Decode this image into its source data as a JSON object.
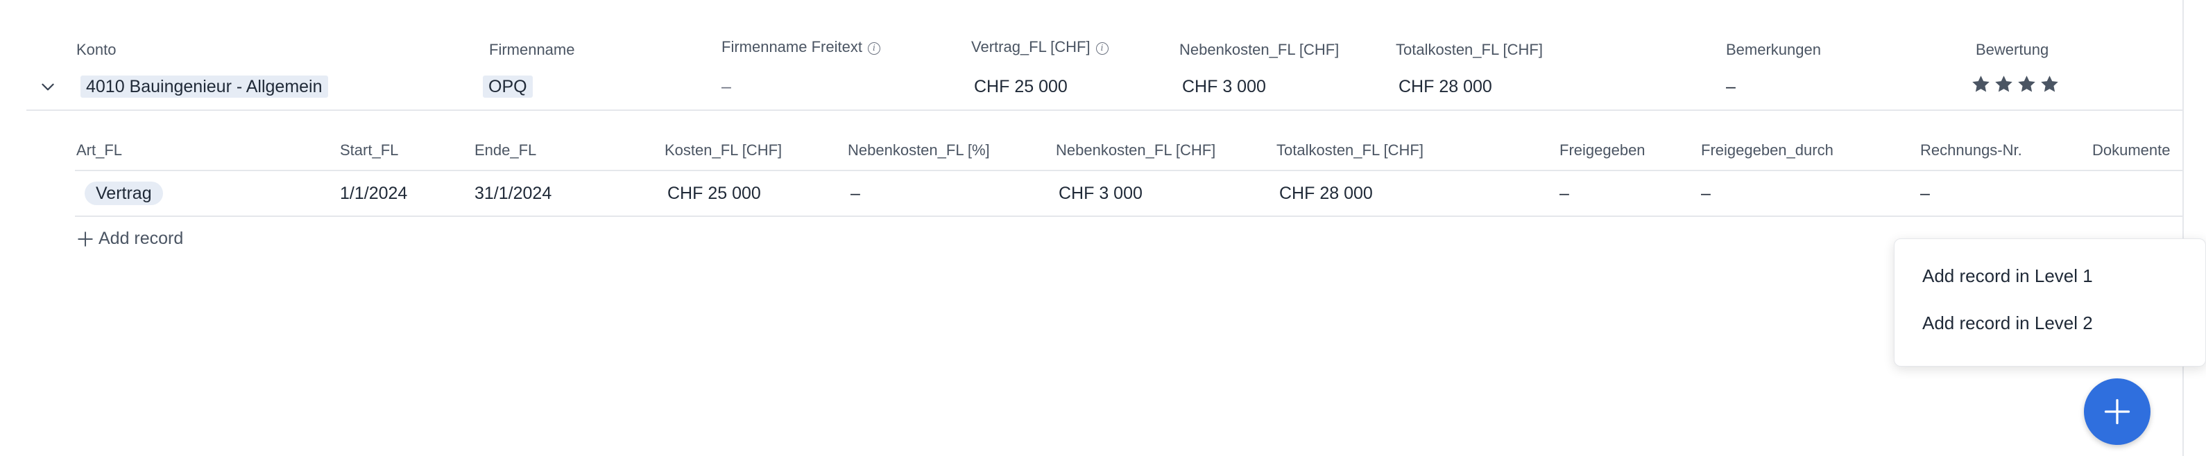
{
  "level1": {
    "headers": {
      "konto": "Konto",
      "firmenname": "Firmenname",
      "firmenname_freitext": "Firmenname Freitext",
      "vertrag": "Vertrag_FL [CHF]",
      "nebenkosten": "Nebenkosten_FL [CHF]",
      "totalkosten": "Totalkosten_FL [CHF]",
      "bemerkungen": "Bemerkungen",
      "bewertung": "Bewertung"
    },
    "row": {
      "konto": "4010 Bauingenieur - Allgemein",
      "firmenname": "OPQ",
      "firmenname_freitext": "–",
      "vertrag": "CHF 25 000",
      "nebenkosten": "CHF 3 000",
      "totalkosten": "CHF 28 000",
      "bemerkungen": "–",
      "bewertung_stars": 4
    }
  },
  "level2": {
    "headers": {
      "art": "Art_FL",
      "start": "Start_FL",
      "ende": "Ende_FL",
      "kosten": "Kosten_FL [CHF]",
      "nebenkosten_pct": "Nebenkosten_FL [%]",
      "nebenkosten_chf": "Nebenkosten_FL [CHF]",
      "totalkosten": "Totalkosten_FL [CHF]",
      "freigegeben": "Freigegeben",
      "freigegeben_durch": "Freigegeben_durch",
      "rechnungs_nr": "Rechnungs-Nr.",
      "dokumente": "Dokumente"
    },
    "row": {
      "art": "Vertrag",
      "start": "1/1/2024",
      "ende": "31/1/2024",
      "kosten": "CHF 25 000",
      "nebenkosten_pct": "–",
      "nebenkosten_chf": "CHF 3 000",
      "totalkosten": "CHF 28 000",
      "freigegeben": "–",
      "freigegeben_durch": "–",
      "rechnungs_nr": "–"
    },
    "add_record": "Add record"
  },
  "menu": {
    "item1": "Add record in Level 1",
    "item2": "Add record in Level 2"
  },
  "colors": {
    "accent": "#2f6fde",
    "chip": "#e6ecf5",
    "star": "#4b5563"
  },
  "icons": [
    "chevron-down-icon",
    "info-icon",
    "star-icon",
    "plus-icon"
  ]
}
